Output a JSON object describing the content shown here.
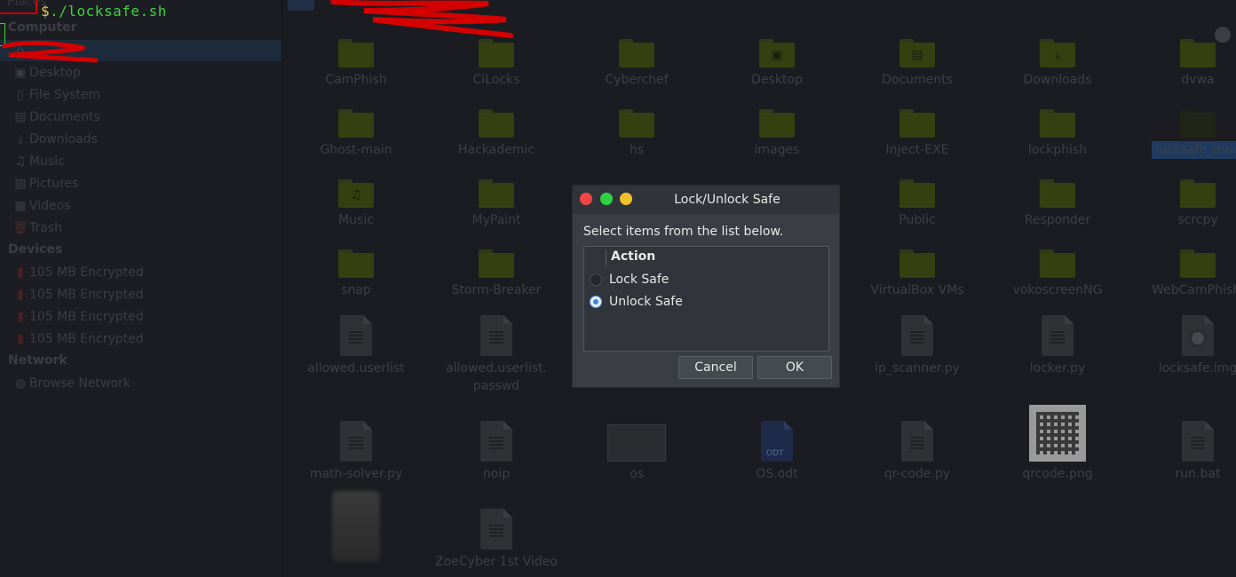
{
  "terminal": {
    "prompt": "$",
    "command": "./locksafe.sh"
  },
  "sidebar": {
    "places_header": "Places",
    "computer_header": "Computer",
    "computer_items": [
      {
        "label": "Desktop",
        "icon": "desktop-icon"
      },
      {
        "label": "File System",
        "icon": "drive-icon"
      },
      {
        "label": "Documents",
        "icon": "document-icon"
      },
      {
        "label": "Downloads",
        "icon": "download-icon"
      },
      {
        "label": "Music",
        "icon": "music-icon"
      },
      {
        "label": "Pictures",
        "icon": "picture-icon"
      },
      {
        "label": "Videos",
        "icon": "video-icon"
      },
      {
        "label": "Trash",
        "icon": "trash-icon"
      }
    ],
    "devices_header": "Devices",
    "device_items": [
      {
        "label": "105 MB Encrypted"
      },
      {
        "label": "105 MB Encrypted"
      },
      {
        "label": "105 MB Encrypted"
      },
      {
        "label": "105 MB Encrypted"
      }
    ],
    "network_header": "Network",
    "network_items": [
      {
        "label": "Browse Network",
        "icon": "globe-icon"
      }
    ]
  },
  "files": [
    {
      "name": "CamPhish",
      "kind": "folder"
    },
    {
      "name": "CiLocks",
      "kind": "folder"
    },
    {
      "name": "Cyberchef",
      "kind": "folder"
    },
    {
      "name": "Desktop",
      "kind": "folder",
      "glyph": "▣"
    },
    {
      "name": "Documents",
      "kind": "folder",
      "glyph": "▤"
    },
    {
      "name": "Downloads",
      "kind": "folder",
      "glyph": "⤓"
    },
    {
      "name": "dvwa",
      "kind": "folder"
    },
    {
      "name": "Ghost-main",
      "kind": "folder"
    },
    {
      "name": "Hackademic",
      "kind": "folder"
    },
    {
      "name": "hs",
      "kind": "folder"
    },
    {
      "name": "images",
      "kind": "folder"
    },
    {
      "name": "Inject-EXE",
      "kind": "folder"
    },
    {
      "name": "lockphish",
      "kind": "folder"
    },
    {
      "name": "locksafe_mou",
      "kind": "folder-dark",
      "selected": true
    },
    {
      "name": "Music",
      "kind": "folder",
      "glyph": "♫"
    },
    {
      "name": "MyPaint",
      "kind": "folder"
    },
    {
      "name": "Public",
      "kind": "folder"
    },
    {
      "name": "Responder",
      "kind": "folder"
    },
    {
      "name": "scrcpy",
      "kind": "folder"
    },
    {
      "name": "snap",
      "kind": "folder"
    },
    {
      "name": "Storm-Breaker",
      "kind": "folder"
    },
    {
      "name": "VirtualBox VMs",
      "kind": "folder"
    },
    {
      "name": "vokoscreenNG",
      "kind": "folder"
    },
    {
      "name": "WebCamPhishi",
      "kind": "folder"
    },
    {
      "name": "allowed.userlist",
      "kind": "doc"
    },
    {
      "name": "allowed.userlist.\npasswd",
      "kind": "doc"
    },
    {
      "name": "ip_scanner.py",
      "kind": "doc"
    },
    {
      "name": "locker.py",
      "kind": "doc"
    },
    {
      "name": "locksafe.img",
      "kind": "disk"
    },
    {
      "name": "math-solver.py",
      "kind": "doc"
    },
    {
      "name": "noip",
      "kind": "doc"
    },
    {
      "name": "os",
      "kind": "image"
    },
    {
      "name": "OS.odt",
      "kind": "odt"
    },
    {
      "name": "qr-code.py",
      "kind": "doc"
    },
    {
      "name": "qrcode.png",
      "kind": "qr"
    },
    {
      "name": "run.bat",
      "kind": "doc"
    },
    {
      "name": "",
      "kind": "blurred"
    },
    {
      "name": "ZoeCyber 1st Video",
      "kind": "doc"
    }
  ],
  "dialog": {
    "title": "Lock/Unlock Safe",
    "prompt": "Select items from the list below.",
    "column_header": "Action",
    "options": [
      {
        "label": "Lock Safe",
        "selected": false
      },
      {
        "label": "Unlock Safe",
        "selected": true
      }
    ],
    "cancel_label": "Cancel",
    "ok_label": "OK"
  },
  "colors": {
    "accent": "#3a86e8",
    "terminal_text": "#3cd13c",
    "close_button": "#f04646",
    "maximize_button": "#2ed142",
    "minimize_button": "#f2c02b",
    "redaction": "#d40000"
  }
}
